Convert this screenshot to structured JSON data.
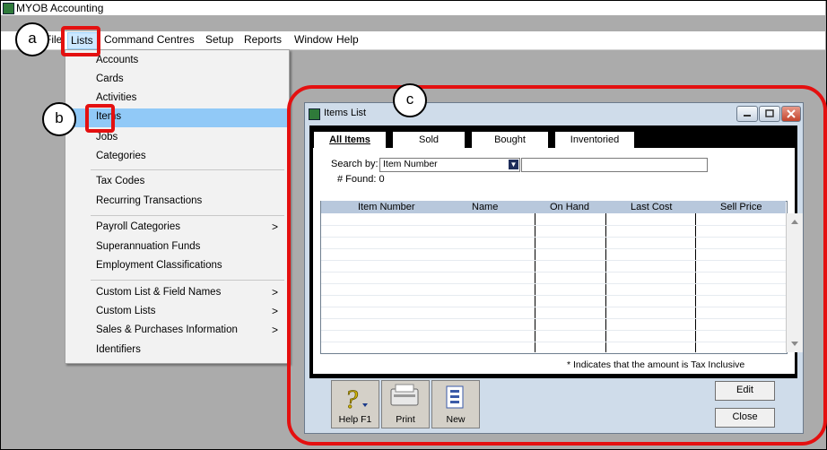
{
  "app": {
    "title": "MYOB Accounting"
  },
  "menubar": {
    "items": [
      {
        "label": "File"
      },
      {
        "label": "Lists"
      },
      {
        "label": "Command Centres"
      },
      {
        "label": "Setup"
      },
      {
        "label": "Reports"
      },
      {
        "label": "Window"
      },
      {
        "label": "Help"
      }
    ]
  },
  "lists_menu": {
    "items": [
      {
        "label": "Accounts"
      },
      {
        "label": "Cards"
      },
      {
        "label": "Activities"
      },
      {
        "label": "Items"
      },
      {
        "label": "Jobs"
      },
      {
        "label": "Categories"
      },
      {
        "label": "Tax Codes"
      },
      {
        "label": "Recurring Transactions"
      },
      {
        "label": "Payroll Categories",
        "submenu": ">"
      },
      {
        "label": "Superannuation Funds"
      },
      {
        "label": "Employment Classifications"
      },
      {
        "label": "Custom List & Field Names",
        "submenu": ">"
      },
      {
        "label": "Custom Lists",
        "submenu": ">"
      },
      {
        "label": "Sales & Purchases Information",
        "submenu": ">"
      },
      {
        "label": "Identifiers"
      }
    ]
  },
  "callouts": {
    "a": "a",
    "b": "b",
    "c": "c"
  },
  "items_window": {
    "title": "Items List",
    "tabs": [
      {
        "label": "All Items"
      },
      {
        "label": "Sold"
      },
      {
        "label": "Bought"
      },
      {
        "label": "Inventoried"
      }
    ],
    "search_by_label": "Search by:",
    "search_by_value": "Item Number",
    "search_input_value": "",
    "found_label": "# Found:",
    "found_count": "0",
    "columns": [
      "Item Number",
      "Name",
      "On Hand",
      "Last Cost",
      "Sell Price"
    ],
    "footnote": "* Indicates that the amount is Tax Inclusive",
    "toolbar": {
      "help": "Help F1",
      "print": "Print",
      "new": "New"
    },
    "edit_label": "Edit",
    "close_label": "Close"
  },
  "colors": {
    "highlight": "#91c9f7",
    "callout_red": "#e41010"
  }
}
